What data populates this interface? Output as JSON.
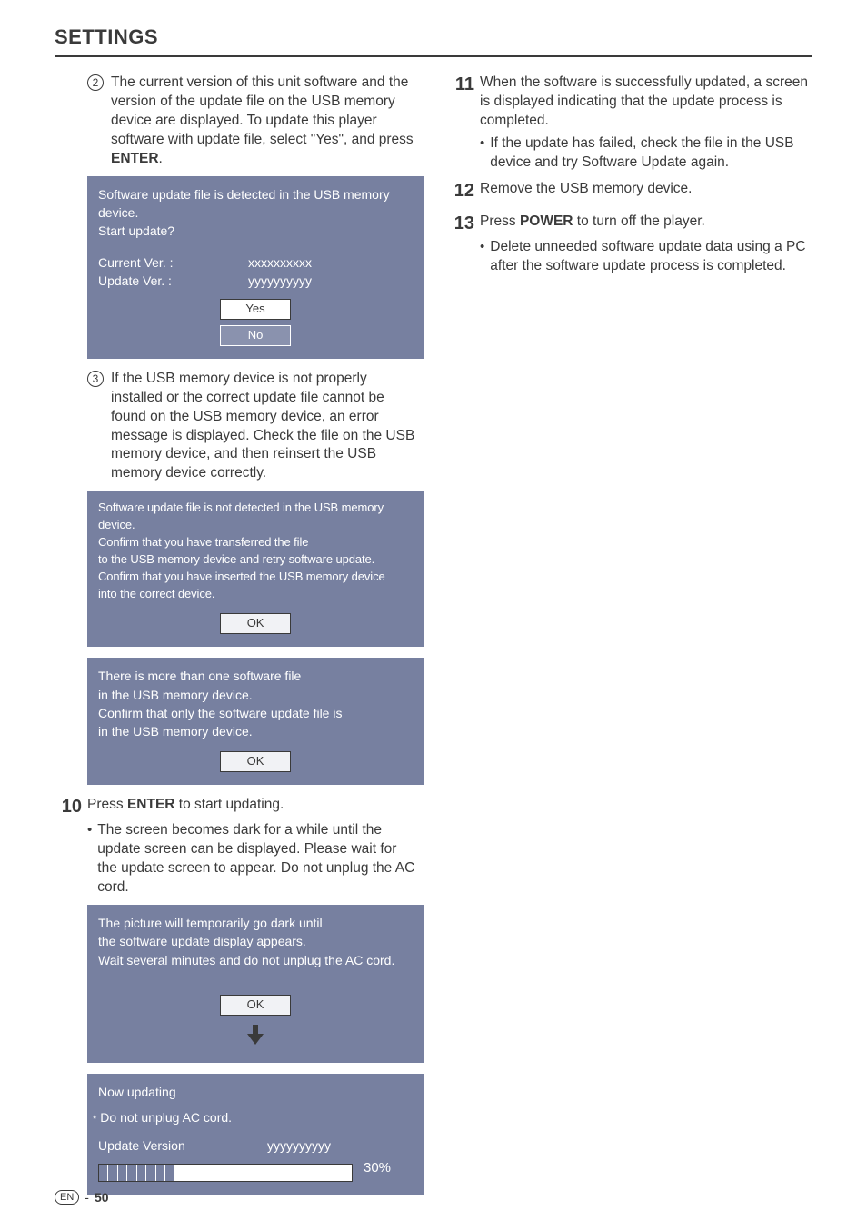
{
  "page": {
    "title": "SETTINGS",
    "language_badge": "EN",
    "page_sep": "-",
    "page_number": "50"
  },
  "left": {
    "step2": {
      "num": "2",
      "text_a": "The current version of this unit software and the version of the update file on the USB memory device are displayed. To update this player software with update file, select \"Yes\", and press ",
      "enter": "ENTER",
      "text_b": "."
    },
    "panel_detected": {
      "line1": "Software update file is detected in the USB memory device.",
      "line2": "Start update?",
      "current_label": "Current Ver. :",
      "current_val": "xxxxxxxxxx",
      "update_label": "Update Ver. :",
      "update_val": "yyyyyyyyyy",
      "yes": "Yes",
      "no": "No"
    },
    "step3": {
      "num": "3",
      "text": "If the USB memory device is not properly installed or the correct update file cannot be found on the USB memory device, an error message is displayed. Check the file on the USB memory device, and then reinsert the USB memory device correctly."
    },
    "panel_notdetected": {
      "l1": "Software update file is not detected in the USB memory device.",
      "l2": "Confirm that you have transferred the file",
      "l3": "to the USB memory device and retry software update.",
      "l4": "Confirm that you have inserted the USB memory device",
      "l5": "into the correct device.",
      "ok": "OK"
    },
    "panel_multiple": {
      "l1": "There is more than one software file",
      "l2": "in the USB memory device.",
      "l3": "Confirm that only the software update file is",
      "l4": "in the USB memory device.",
      "ok": "OK"
    },
    "step10": {
      "num": "10",
      "text_a": "Press ",
      "enter": "ENTER",
      "text_b": " to start updating.",
      "bullet": "The screen becomes dark for a while until the update screen can be displayed. Please wait for the update screen to appear. Do not unplug the AC cord."
    },
    "panel_dark": {
      "l1": "The picture will temporarily go dark until",
      "l2": "the software update display appears.",
      "l3": "Wait several minutes and do not unplug the AC cord.",
      "ok": "OK"
    },
    "panel_progress": {
      "l1": "Now updating",
      "l2": "Do not unplug AC cord.",
      "ver_label": "Update Version",
      "ver_val": "yyyyyyyyyy",
      "pct": "30%"
    }
  },
  "right": {
    "step11": {
      "num": "11",
      "text": "When the software is successfully updated, a screen is displayed indicating that the update process is completed.",
      "bullet": "If the update has failed, check the file in the USB device and try Software Update again."
    },
    "step12": {
      "num": "12",
      "text": "Remove the USB memory device."
    },
    "step13": {
      "num": "13",
      "text_a": "Press ",
      "power": "POWER",
      "text_b": " to turn off the player.",
      "bullet": "Delete unneeded software update data using a PC after the software update process is completed."
    }
  }
}
